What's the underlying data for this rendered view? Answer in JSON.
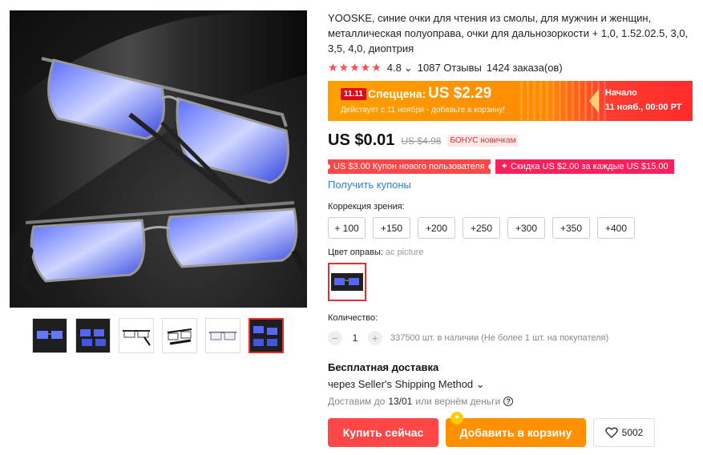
{
  "product": {
    "title": "YOOSKE, синие очки для чтения из смолы, для мужчин и женщин, металлическая полуоправа, очки для дальнозоркости + 1,0, 1.52.02.5, 3,0, 3,5, 4,0, диоптрия",
    "rating": "4.8",
    "rating_suffix": "⌄",
    "stars": "★★★★★",
    "reviews": "1087 Отзывы",
    "orders": "1424 заказа(ов)"
  },
  "promo": {
    "badge": "11.11",
    "label": "Спеццена:",
    "price": "US $2.29",
    "note": "Действует с 11 ноября - добавьте в корзину!",
    "start_label": "Начало",
    "start_date": "11 нояб., 00:00 PT"
  },
  "price": {
    "current": "US $0.01",
    "old": "US $4.98",
    "bonus": "БОНУС новичкам"
  },
  "coupons": {
    "new_user": "US $3.00 Купон нового пользователя",
    "discount": "✦ Скидка US $2.00 за каждые US $15.00",
    "get_link": "Получить купоны"
  },
  "vision": {
    "label": "Коррекция зрения:",
    "options": [
      "+ 100",
      "+150",
      "+200",
      "+250",
      "+300",
      "+350",
      "+400"
    ]
  },
  "frame_color": {
    "label": "Цвет оправы:",
    "value": "ac picture"
  },
  "quantity": {
    "label": "Количество:",
    "minus": "−",
    "value": "1",
    "plus": "+",
    "stock": "337500 шт. в наличии (Не более 1 шт. на покупателя)"
  },
  "shipping": {
    "title": "Бесплатная доставка",
    "method": "через Seller's Shipping Method ⌄",
    "guarantee_prefix": "Доставим до",
    "guarantee_date": "13/01",
    "guarantee_suffix": "или вернём деньги",
    "help_glyph": "?"
  },
  "actions": {
    "buy": "Купить сейчас",
    "cart": "Добавить в корзину",
    "cart_spark": "✦",
    "wishlist_count": "5002"
  },
  "colors": {
    "accent_red": "#ff4747",
    "accent_orange": "#ff9000",
    "link_blue": "#2e7fd6"
  }
}
